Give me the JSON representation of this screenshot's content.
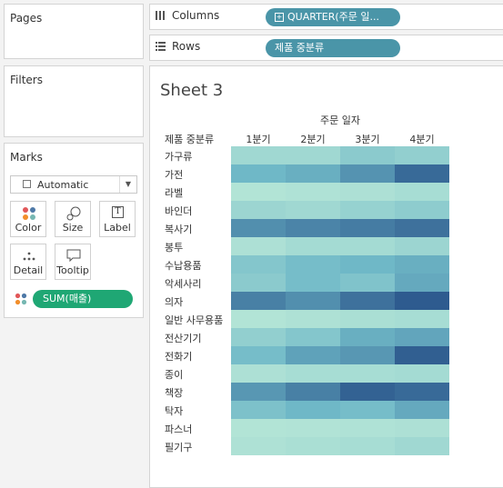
{
  "panels": {
    "pages": "Pages",
    "filters": "Filters",
    "marks": "Marks"
  },
  "marks": {
    "type": "Automatic",
    "buttons": {
      "color": "Color",
      "size": "Size",
      "label": "Label",
      "detail": "Detail",
      "tooltip": "Tooltip"
    },
    "measure_pill": "SUM(매출)"
  },
  "shelves": {
    "columns": {
      "label": "Columns",
      "pill": "QUARTER(주문 일..."
    },
    "rows": {
      "label": "Rows",
      "pill": "제품 중분류"
    }
  },
  "sheet": {
    "title": "Sheet 3",
    "column_header": "주문 일자",
    "row_header": "제품 중분류"
  },
  "colors": {
    "pill_blue": "#4a95a8",
    "pill_green": "#1fa774",
    "low": "#b5e6d7",
    "high": "#2e5b8f"
  },
  "chart_data": {
    "type": "heatmap",
    "title": "Sheet 3",
    "x_label": "주문 일자",
    "y_label": "제품 중분류",
    "x": [
      "1분기",
      "2분기",
      "3분기",
      "4분기"
    ],
    "y": [
      "가구류",
      "가전",
      "라벨",
      "바인더",
      "복사기",
      "봉투",
      "수납용품",
      "악세사리",
      "의자",
      "일반 사무용품",
      "전산기기",
      "전화기",
      "종이",
      "책장",
      "탁자",
      "파스너",
      "필기구"
    ],
    "values": [
      [
        0.15,
        0.15,
        0.3,
        0.25
      ],
      [
        0.5,
        0.55,
        0.7,
        0.92
      ],
      [
        0.02,
        0.04,
        0.06,
        0.1
      ],
      [
        0.18,
        0.15,
        0.22,
        0.28
      ],
      [
        0.72,
        0.78,
        0.82,
        0.88
      ],
      [
        0.06,
        0.12,
        0.12,
        0.18
      ],
      [
        0.35,
        0.45,
        0.5,
        0.55
      ],
      [
        0.3,
        0.45,
        0.38,
        0.58
      ],
      [
        0.8,
        0.72,
        0.88,
        1.0
      ],
      [
        0.02,
        0.05,
        0.08,
        0.1
      ],
      [
        0.25,
        0.35,
        0.55,
        0.6
      ],
      [
        0.45,
        0.62,
        0.68,
        0.98
      ],
      [
        0.06,
        0.1,
        0.1,
        0.12
      ],
      [
        0.68,
        0.8,
        0.96,
        0.92
      ],
      [
        0.4,
        0.5,
        0.45,
        0.58
      ],
      [
        0.02,
        0.03,
        0.04,
        0.06
      ],
      [
        0.05,
        0.08,
        0.1,
        0.15
      ]
    ],
    "color_scale": "sequential teal-blue (low to high)"
  }
}
